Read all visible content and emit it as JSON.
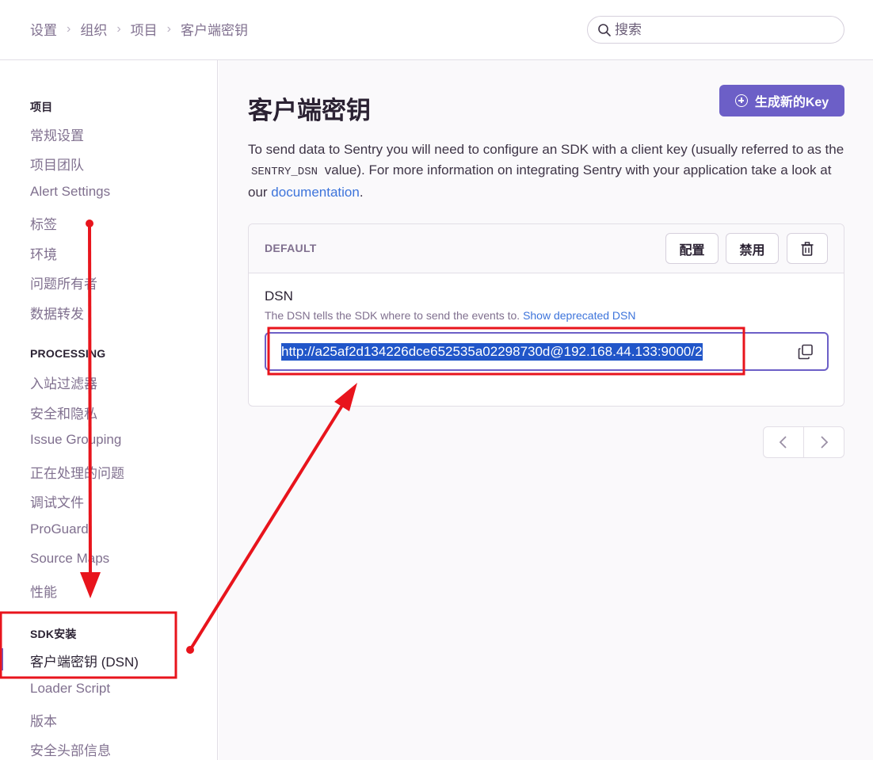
{
  "header": {
    "breadcrumbs": [
      "设置",
      "组织",
      "项目",
      "客户端密钥"
    ],
    "search": {
      "placeholder": "搜索"
    }
  },
  "sidebar": {
    "sections": [
      {
        "heading": "项目",
        "items": [
          "常规设置",
          "项目团队",
          "Alert Settings",
          "标签",
          "环境",
          "问题所有者",
          "数据转发"
        ]
      },
      {
        "heading": "PROCESSING",
        "items": [
          "入站过滤器",
          "安全和隐私",
          "Issue Grouping",
          "正在处理的问题",
          "调试文件",
          "ProGuard",
          "Source Maps",
          "性能"
        ]
      },
      {
        "heading": "SDK安装",
        "items": [
          "客户端密钥 (DSN)",
          "Loader Script",
          "版本",
          "安全头部信息"
        ]
      }
    ],
    "active_item": "客户端密钥 (DSN)"
  },
  "main": {
    "title": "客户端密钥",
    "generate_button": "生成新的Key",
    "intro": {
      "part1": "To send data to Sentry you will need to configure an SDK with a client key (usually referred to as the ",
      "code": "SENTRY_DSN",
      "part2": " value). For more information on integrating Sentry with your application take a look at our ",
      "link": "documentation",
      "part3": "."
    },
    "key_panel": {
      "title": "DEFAULT",
      "configure_button": "配置",
      "disable_button": "禁用",
      "delete_icon": "trash-icon",
      "dsn_label": "DSN",
      "dsn_help": "The DSN tells the SDK where to send the events to. ",
      "dsn_help_link": "Show deprecated DSN",
      "dsn_value": "http://a25af2d134226dce652535a02298730d@192.168.44.133:9000/2",
      "copy_icon": "copy-icon"
    },
    "pagination": {
      "prev_icon": "chevron-left-icon",
      "next_icon": "chevron-right-icon"
    }
  },
  "colors": {
    "accent": "#6c5fc7",
    "annotation": "#e8141c",
    "link": "#3d74db",
    "selection": "#2156c9"
  }
}
